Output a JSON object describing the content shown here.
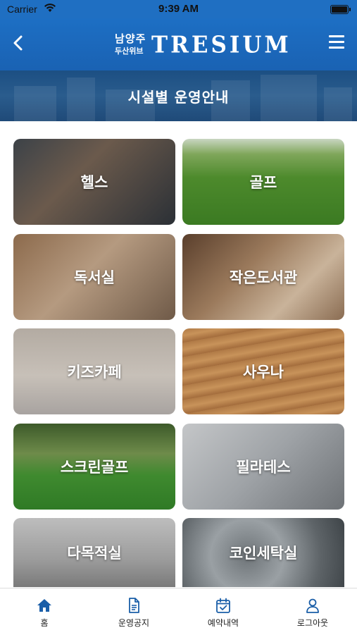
{
  "status_bar": {
    "carrier": "Carrier",
    "time": "9:39 AM"
  },
  "header": {
    "logo_korean_line1": "남양주",
    "logo_korean_line2": "두산위브",
    "logo_english": "TRESIUM"
  },
  "banner": {
    "title": "시설별 운영안내"
  },
  "facilities": [
    {
      "label": "헬스"
    },
    {
      "label": "골프"
    },
    {
      "label": "독서실"
    },
    {
      "label": "작은도서관"
    },
    {
      "label": "키즈카페"
    },
    {
      "label": "사우나"
    },
    {
      "label": "스크린골프"
    },
    {
      "label": "필라테스"
    },
    {
      "label": "다목적실"
    },
    {
      "label": "코인세탁실"
    }
  ],
  "tabbar": {
    "items": [
      {
        "label": "홈",
        "icon": "home-icon"
      },
      {
        "label": "운영공지",
        "icon": "document-icon"
      },
      {
        "label": "예약내역",
        "icon": "calendar-check-icon"
      },
      {
        "label": "로그아웃",
        "icon": "user-icon"
      }
    ]
  },
  "colors": {
    "primary": "#1d6fc4",
    "tab_icon": "#1a5ea8"
  }
}
